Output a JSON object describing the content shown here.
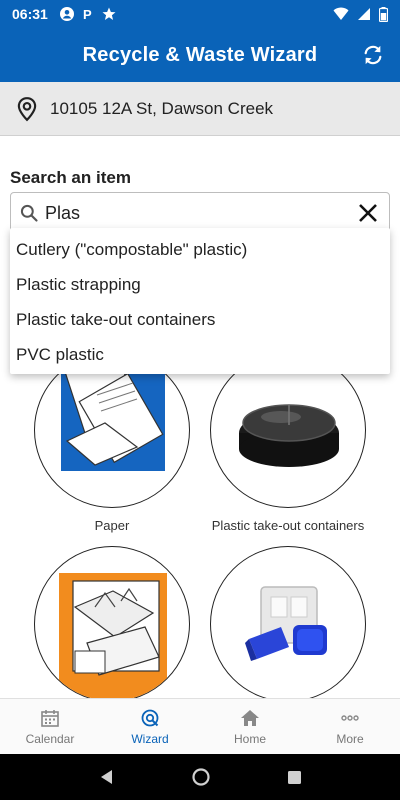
{
  "status_bar": {
    "time": "06:31",
    "left_icons": [
      "account-circle-icon",
      "parking-icon",
      "star-icon"
    ],
    "right_icons": [
      "wifi-icon",
      "signal-icon",
      "battery-icon"
    ]
  },
  "app_bar": {
    "title": "Recycle & Waste Wizard",
    "refresh_icon": "refresh-icon"
  },
  "address": {
    "icon": "location-pin-icon",
    "text": "10105 12A St, Dawson Creek"
  },
  "search": {
    "label": "Search an item",
    "value": "Plas",
    "search_icon": "search-icon",
    "clear_icon": "close-icon"
  },
  "suggestions": [
    "Cutlery (\"compostable\" plastic)",
    "Plastic strapping",
    "Plastic take-out containers",
    "PVC plastic"
  ],
  "tiles": [
    {
      "caption": "Paper"
    },
    {
      "caption": "Plastic take-out containers"
    },
    {
      "caption": ""
    },
    {
      "caption": ""
    }
  ],
  "bottom_nav": [
    {
      "label": "Calendar",
      "icon": "calendar-icon",
      "active": false
    },
    {
      "label": "Wizard",
      "icon": "wizard-icon",
      "active": true
    },
    {
      "label": "Home",
      "icon": "home-icon",
      "active": false
    },
    {
      "label": "More",
      "icon": "more-icon",
      "active": false
    }
  ],
  "colors": {
    "primary": "#0a63b8",
    "address_bg": "#e9e9e9",
    "inactive_nav": "#777777"
  }
}
